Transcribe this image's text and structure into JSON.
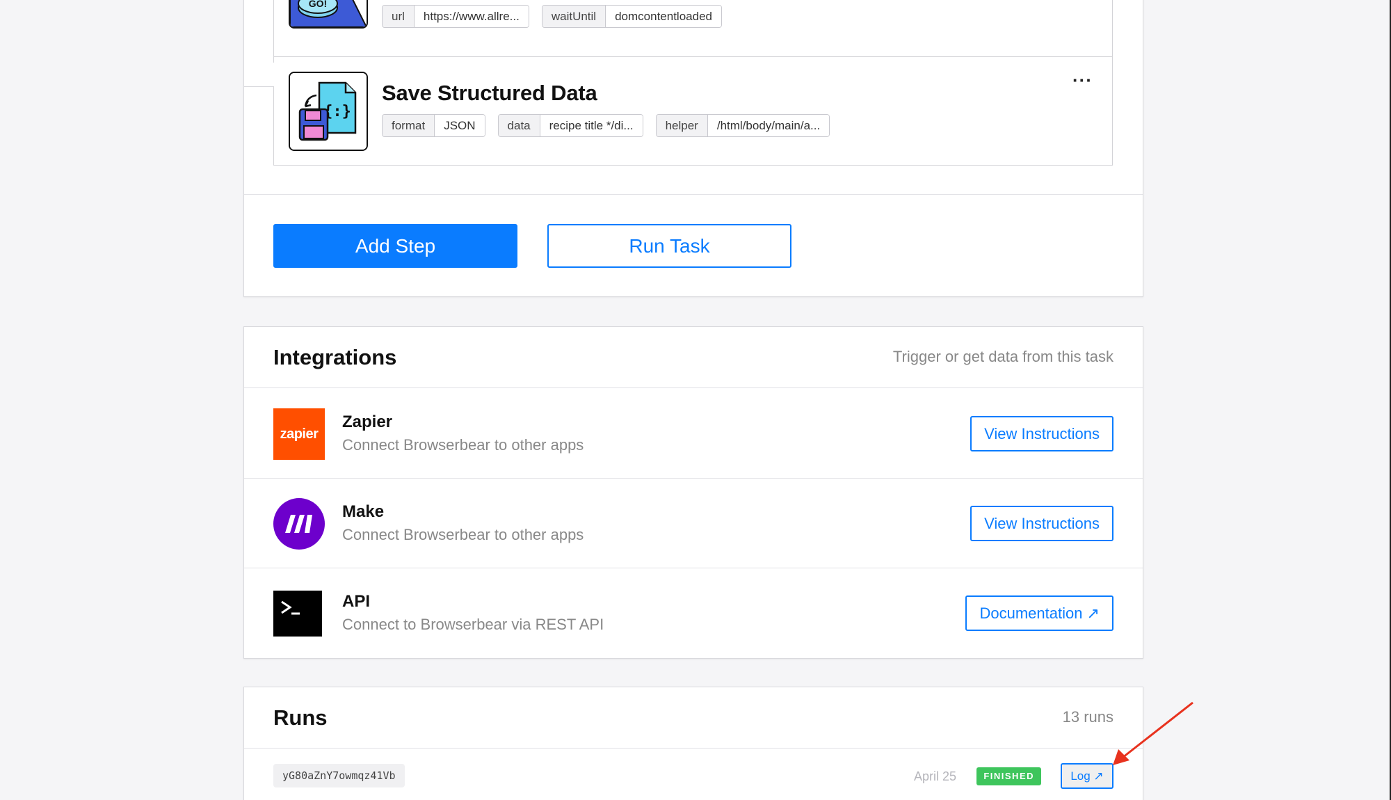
{
  "steps": {
    "previous": {
      "params": [
        {
          "key": "url",
          "value": "https://www.allre..."
        },
        {
          "key": "waitUntil",
          "value": "domcontentloaded"
        }
      ],
      "icon": "go-navigate-icon"
    },
    "current": {
      "title": "Save Structured Data",
      "more_label": "···",
      "icon": "save-structured-data-icon",
      "params": [
        {
          "key": "format",
          "value": "JSON"
        },
        {
          "key": "data",
          "value": "recipe title */di..."
        },
        {
          "key": "helper",
          "value": "/html/body/main/a..."
        }
      ]
    },
    "add_step_label": "Add Step",
    "run_task_label": "Run Task"
  },
  "integrations": {
    "title": "Integrations",
    "subtitle": "Trigger or get data from this task",
    "items": [
      {
        "name": "Zapier",
        "description": "Connect Browserbear to other apps",
        "button": "View Instructions",
        "logo_text": "zapier",
        "color": "#ff4f00"
      },
      {
        "name": "Make",
        "description": "Connect Browserbear to other apps",
        "button": "View Instructions",
        "color": "#6d00cc"
      },
      {
        "name": "API",
        "description": "Connect to Browserbear via REST API",
        "button": "Documentation ↗",
        "color": "#000000"
      }
    ]
  },
  "runs": {
    "title": "Runs",
    "count_label": "13 runs",
    "items": [
      {
        "id": "yG80aZnY7owmqz41Vb",
        "date": "April 25",
        "status": "FINISHED",
        "log_label": "Log ↗"
      }
    ]
  },
  "colors": {
    "accent": "#0a7cff",
    "status_finished": "#3ec55c",
    "annotation_arrow": "#e8321e"
  }
}
